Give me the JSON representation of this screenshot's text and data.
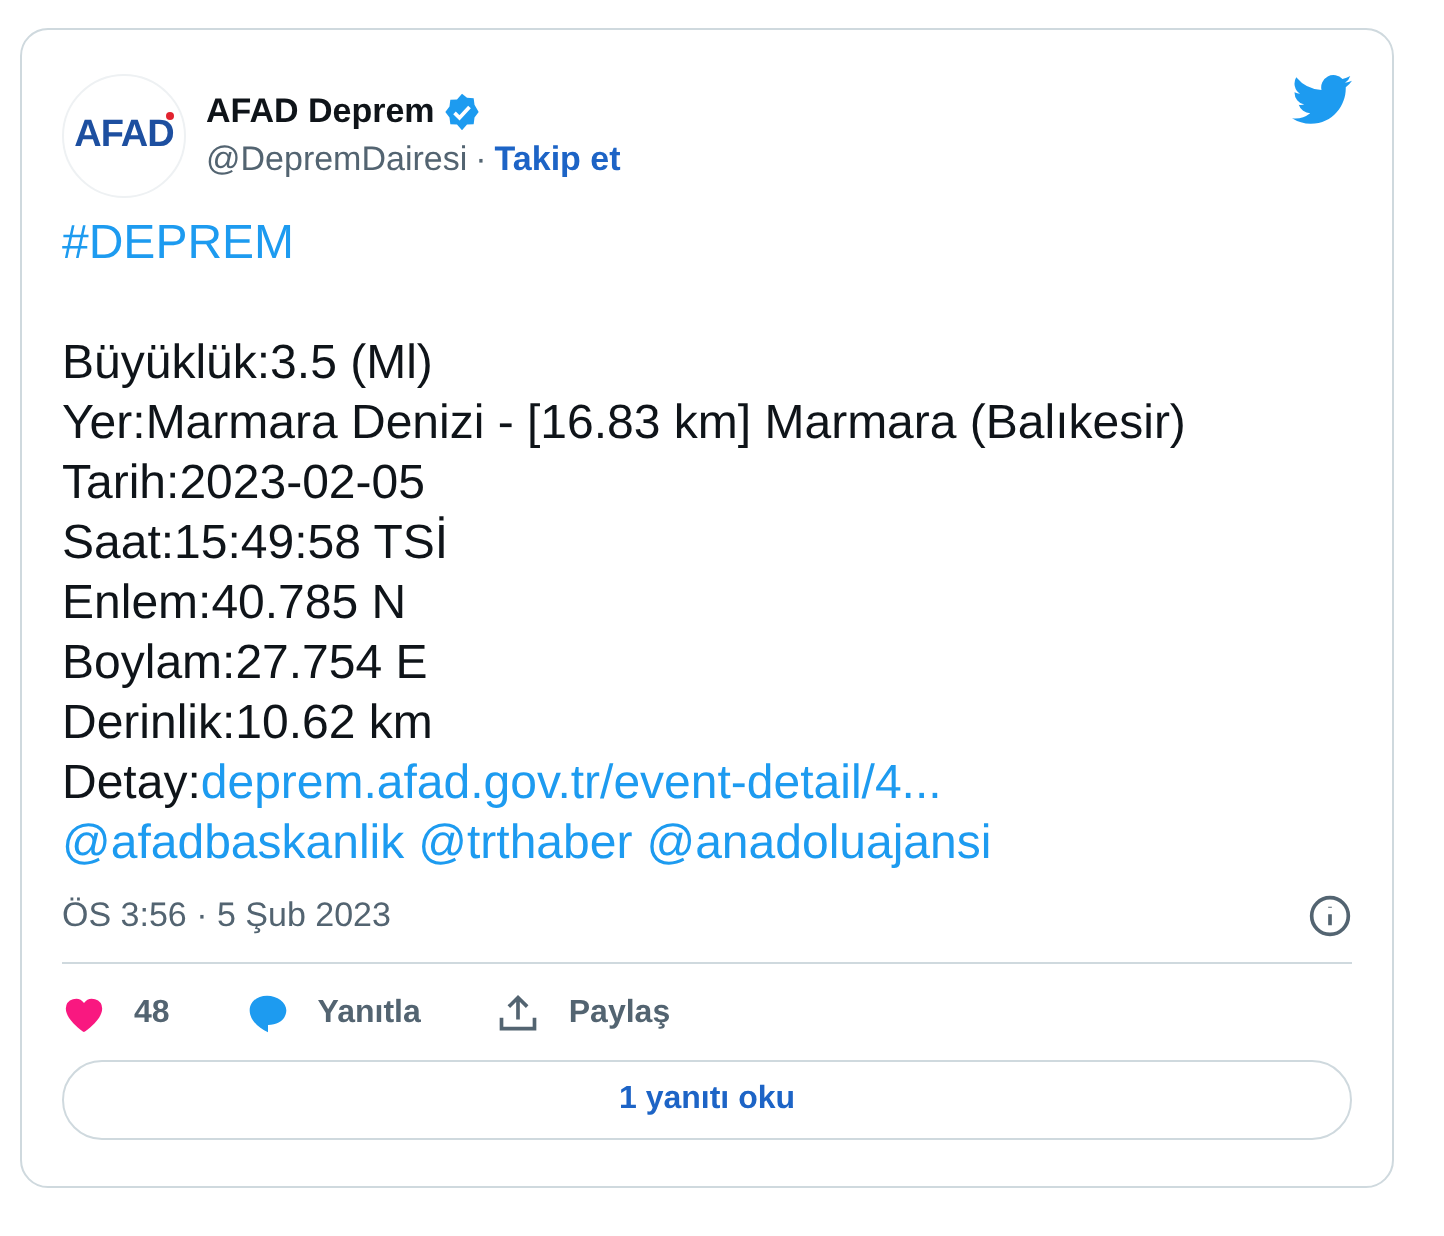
{
  "author": {
    "avatar": "AFAD",
    "name": "AFAD Deprem",
    "verified": true,
    "handle": "@DepremDairesi",
    "separator": "·",
    "follow": "Takip et"
  },
  "hashtag": "#DEPREM",
  "lines": [
    {
      "segments": [
        {
          "text": "Büyüklük:3.5 (Ml)",
          "link": false
        }
      ]
    },
    {
      "segments": [
        {
          "text": "Yer:Marmara Denizi - [16.83 km] Marmara (Balıkesir)",
          "link": false
        }
      ]
    },
    {
      "segments": [
        {
          "text": "Tarih:2023-02-05",
          "link": false
        }
      ]
    },
    {
      "segments": [
        {
          "text": "Saat:15:49:58 TSİ",
          "link": false
        }
      ]
    },
    {
      "segments": [
        {
          "text": "Enlem:40.785 N",
          "link": false
        }
      ]
    },
    {
      "segments": [
        {
          "text": "Boylam:27.754 E",
          "link": false
        }
      ]
    },
    {
      "segments": [
        {
          "text": "Derinlik:10.62 km",
          "link": false
        }
      ]
    },
    {
      "segments": [
        {
          "text": "Detay:",
          "link": false
        },
        {
          "text": "deprem.afad.gov.tr/event-detail/4...",
          "link": true
        }
      ]
    },
    {
      "segments": [
        {
          "text": "@afadbaskanlik",
          "link": true
        },
        {
          "text": "@trthaber",
          "link": true
        },
        {
          "text": "@anadoluajansi",
          "link": true
        }
      ]
    }
  ],
  "timestamp": "ÖS 3:56 · 5 Şub 2023",
  "actions": [
    {
      "kind": "like",
      "label": "48"
    },
    {
      "kind": "reply",
      "label": "Yanıtla"
    },
    {
      "kind": "share",
      "label": "Paylaş"
    }
  ],
  "read_replies": "1 yanıtı oku"
}
